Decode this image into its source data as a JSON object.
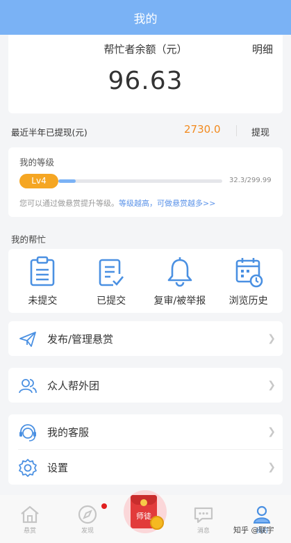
{
  "header": {
    "title": "我的"
  },
  "balance": {
    "label": "帮忙者余额（元）",
    "detail": "明细",
    "amount": "96.63"
  },
  "withdraw": {
    "label": "最近半年已提现(元)",
    "amount": "2730.0",
    "button": "提现"
  },
  "level": {
    "title": "我的等级",
    "badge": "Lv4",
    "progress_text": "32.3/299.99",
    "progress_fraction": 0.108,
    "tip_plain": "您可以通过做悬赏提升等级。",
    "tip_highlight": "等级越高，可做悬赏越多>>"
  },
  "help": {
    "section_title": "我的帮忙",
    "items": [
      {
        "label": "未提交",
        "icon": "clipboard-icon"
      },
      {
        "label": "已提交",
        "icon": "checklist-icon"
      },
      {
        "label": "复审/被举报",
        "icon": "bell-icon"
      },
      {
        "label": "浏览历史",
        "icon": "calendar-clock-icon"
      }
    ]
  },
  "menu": {
    "publish": {
      "label": "发布/管理悬赏",
      "icon": "paper-plane-icon"
    },
    "group": {
      "label": "众人帮外团",
      "icon": "group-icon"
    },
    "service": {
      "label": "我的客服",
      "icon": "headset-icon"
    },
    "settings": {
      "label": "设置",
      "icon": "gear-icon"
    }
  },
  "tabbar": {
    "items": [
      {
        "label": "悬赏",
        "icon": "home-icon"
      },
      {
        "label": "发现",
        "icon": "compass-icon"
      },
      {
        "label": "师徒",
        "icon": "red-envelope-icon"
      },
      {
        "label": "消息",
        "icon": "chat-icon"
      },
      {
        "label": "我的",
        "icon": "person-icon"
      }
    ]
  },
  "watermark": "知乎 @联宇",
  "colors": {
    "header": "#7ab2f5",
    "accent_orange": "#f28a1e",
    "badge": "#f5a623",
    "link_blue": "#5a92e8"
  }
}
